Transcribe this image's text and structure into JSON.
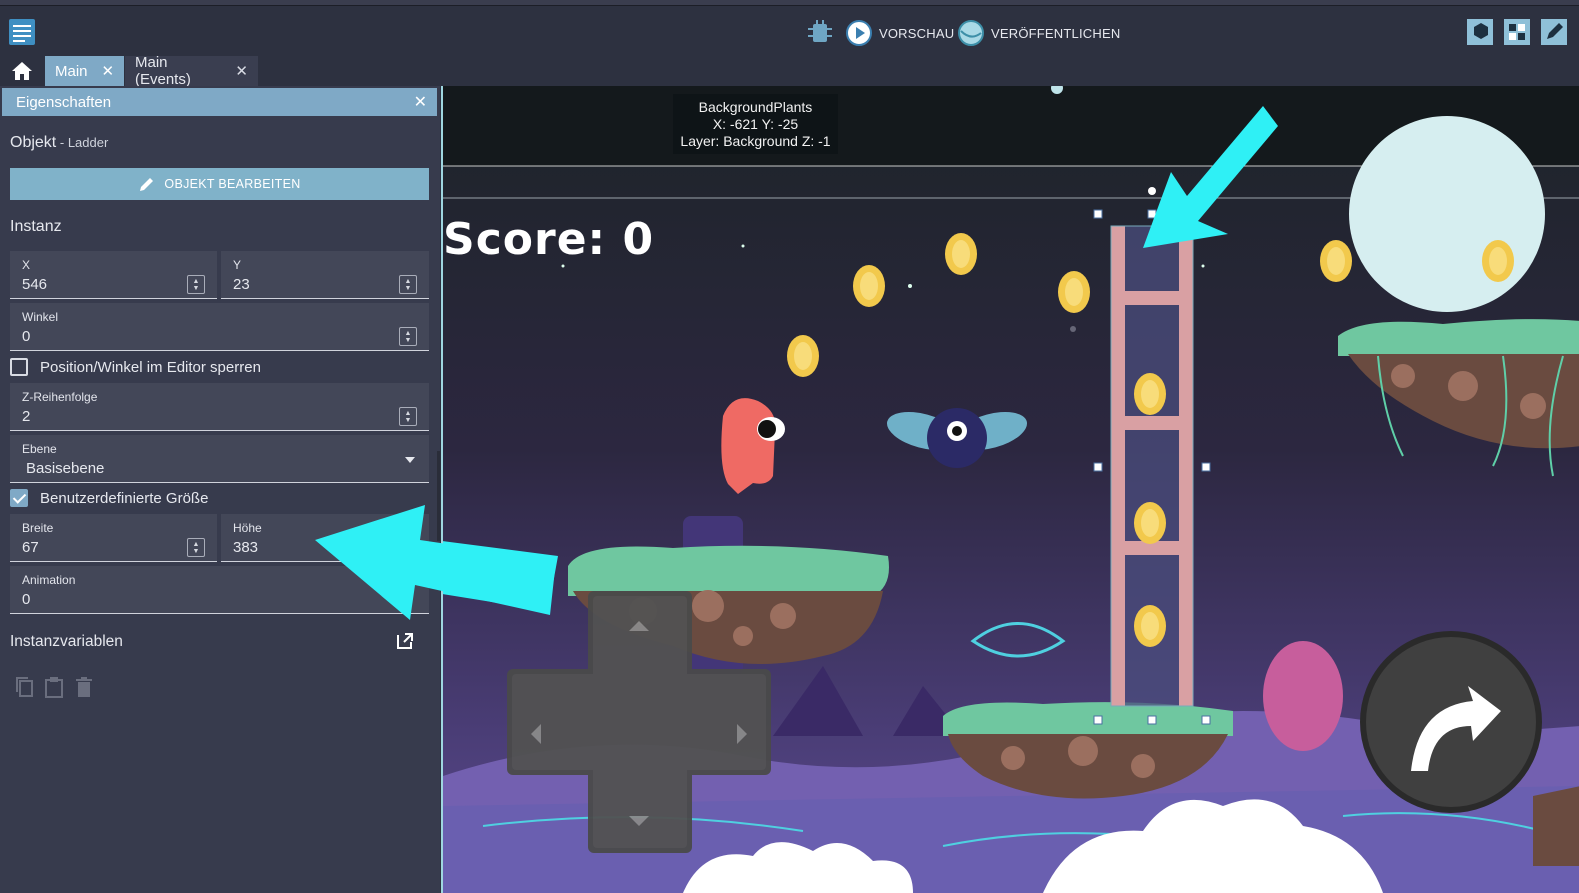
{
  "toolbar": {
    "preview_label": "VORSCHAU",
    "publish_label": "VERÖFFENTLICHEN"
  },
  "tabs": [
    {
      "label": "Main",
      "active": true
    },
    {
      "label": "Main (Events)",
      "active": false
    }
  ],
  "properties": {
    "header": "Eigenschaften",
    "object_prefix": "Objekt",
    "object_separator": " - ",
    "object_name": "Ladder",
    "edit_object_label": "OBJEKT BEARBEITEN",
    "instance_heading": "Instanz",
    "x_label": "X",
    "x_value": "546",
    "y_label": "Y",
    "y_value": "23",
    "angle_label": "Winkel",
    "angle_value": "0",
    "lock_label": "Position/Winkel im Editor sperren",
    "lock_checked": false,
    "z_label": "Z-Reihenfolge",
    "z_value": "2",
    "layer_label": "Ebene",
    "layer_value": "Basisebene",
    "custom_size_label": "Benutzerdefinierte Größe",
    "custom_size_checked": true,
    "width_label": "Breite",
    "width_value": "67",
    "height_label": "Höhe",
    "height_value": "383",
    "animation_label": "Animation",
    "animation_value": "0",
    "instance_vars_heading": "Instanzvariablen"
  },
  "scene": {
    "tooltip_line1": "BackgroundPlants",
    "tooltip_line2": "X: -621  Y: -25",
    "tooltip_line3": "Layer: Background  Z: -1",
    "score_text": "Score: 0"
  },
  "colors": {
    "accent": "#80b2c9",
    "panel_bg": "#373b4d",
    "arrow": "#2ff0f5"
  }
}
